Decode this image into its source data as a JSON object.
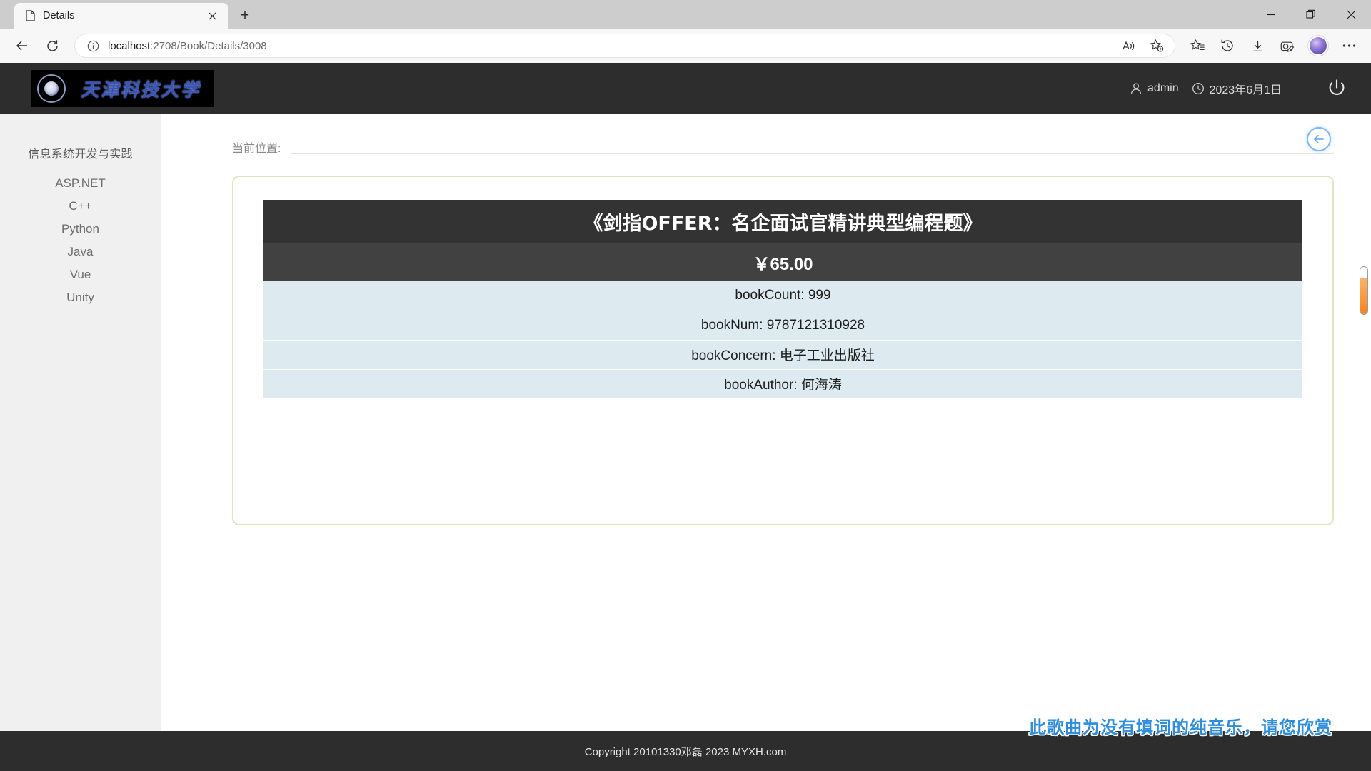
{
  "browser": {
    "tab": {
      "title": "Details",
      "favicon_icon": "page-icon",
      "close_icon": "close-icon"
    },
    "new_tab_label": "+",
    "window_controls": {
      "minimize": "—",
      "restore": "❐",
      "close": "✕"
    },
    "nav": {
      "back_icon": "back-arrow-icon",
      "refresh_icon": "refresh-icon"
    },
    "omnibox": {
      "info_icon": "info-circle-icon",
      "url_host": "localhost",
      "url_path": ":2708/Book/Details/3008",
      "read_aloud_icon": "read-aloud-icon",
      "add_favorite_icon": "add-favorite-star-icon"
    },
    "toolbar_icons": [
      {
        "name": "favorites-icon",
        "glyph": "star-list"
      },
      {
        "name": "history-icon",
        "glyph": "clock-back"
      },
      {
        "name": "downloads-icon",
        "glyph": "download-arrow"
      },
      {
        "name": "collections-icon",
        "glyph": "camera-pen"
      },
      {
        "name": "profile-avatar",
        "glyph": "avatar"
      },
      {
        "name": "settings-and-more-icon",
        "glyph": "ellipsis"
      }
    ]
  },
  "site": {
    "logo_text": "天津科技大学",
    "user": {
      "icon": "user-icon",
      "name": "admin"
    },
    "date": {
      "icon": "clock-icon",
      "value": "2023年6月1日"
    },
    "logout_icon": "power-icon"
  },
  "sidebar": {
    "heading": "信息系统开发与实践",
    "items": [
      {
        "label": "ASP.NET"
      },
      {
        "label": "C++"
      },
      {
        "label": "Python"
      },
      {
        "label": "Java"
      },
      {
        "label": "Vue"
      },
      {
        "label": "Unity"
      }
    ]
  },
  "content": {
    "breadcrumb_label": "当前位置:",
    "back_button_icon": "back-arrow-circle-icon",
    "book": {
      "title": "《剑指OFFER：名企面试官精讲典型编程题》",
      "price": "￥65.00",
      "details": [
        {
          "label": "bookCount",
          "value": "999",
          "text": "bookCount: 999"
        },
        {
          "label": "bookNum",
          "value": "9787121310928",
          "text": "bookNum: 9787121310928"
        },
        {
          "label": "bookConcern",
          "value": "电子工业出版社",
          "text": "bookConcern: 电子工业出版社"
        },
        {
          "label": "bookAuthor",
          "value": "何海涛",
          "text": "bookAuthor: 何海涛"
        }
      ]
    }
  },
  "footer": {
    "copyright": "Copyright 20101330邓磊 2023 MYXH.com",
    "marquee": "此歌曲为没有填词的纯音乐，请您欣赏"
  },
  "colors": {
    "header_bg": "#2d2d2d",
    "card_border": "#dde5c4",
    "row_title_bg": "#333333",
    "row_price_bg": "#414141",
    "row_data_bg": "#ddeaf0",
    "accent_blue": "#7eb6f5",
    "marquee_blue": "#2f8ddb",
    "scrollbar_orange": "#f58220"
  }
}
